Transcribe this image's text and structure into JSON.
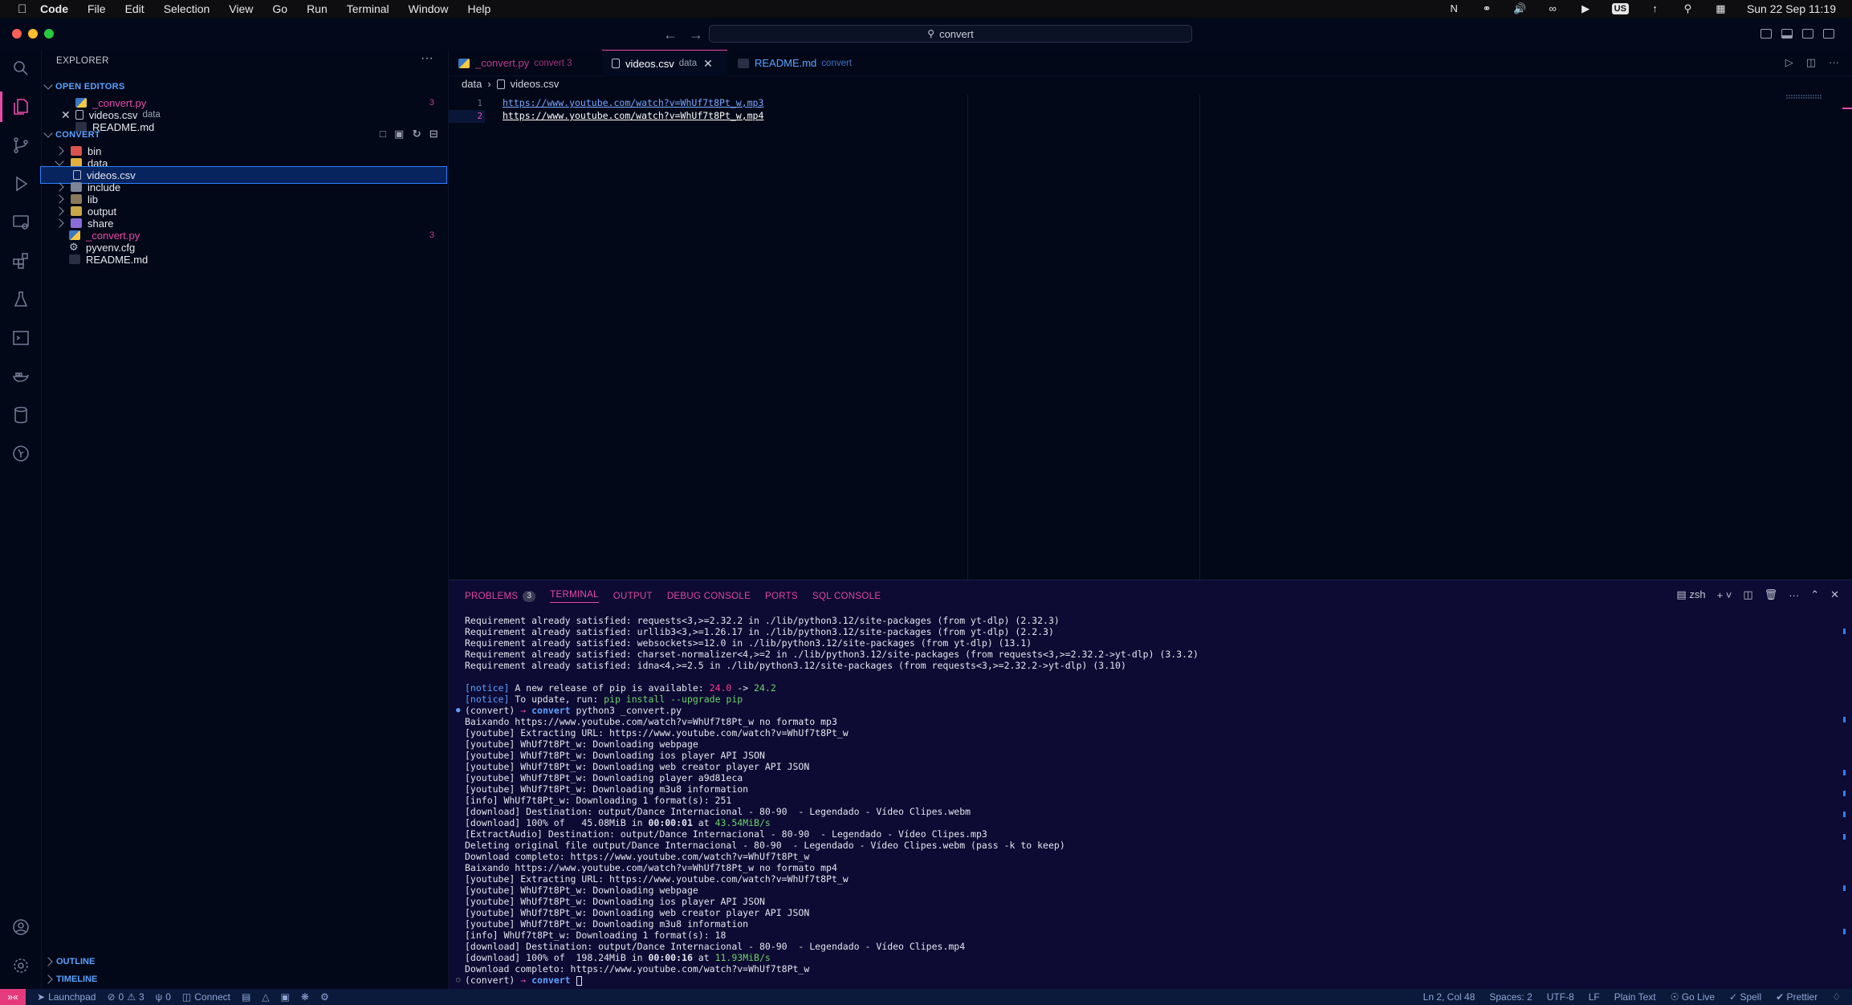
{
  "menubar": {
    "app": "Code",
    "items": [
      "File",
      "Edit",
      "Selection",
      "View",
      "Go",
      "Run",
      "Terminal",
      "Window",
      "Help"
    ],
    "clock": "Sun 22 Sep  11:19",
    "input": "US"
  },
  "titlebar": {
    "search": "convert"
  },
  "explorer": {
    "title": "EXPLORER",
    "open_editors_label": "OPEN EDITORS",
    "open_editors": [
      {
        "name": "_convert.py",
        "badge": "3"
      },
      {
        "name": "videos.csv",
        "desc": "data"
      },
      {
        "name": "README.md"
      }
    ],
    "folder_label": "CONVERT",
    "tree": [
      {
        "name": "bin"
      },
      {
        "name": "data"
      },
      {
        "name": "videos.csv"
      },
      {
        "name": "include"
      },
      {
        "name": "lib"
      },
      {
        "name": "output"
      },
      {
        "name": "share"
      },
      {
        "name": "_convert.py",
        "badge": "3"
      },
      {
        "name": "pyvenv.cfg"
      },
      {
        "name": "README.md"
      }
    ],
    "outline": "OUTLINE",
    "timeline": "TIMELINE"
  },
  "tabs": [
    {
      "name": "_convert.py",
      "desc": "convert 3"
    },
    {
      "name": "videos.csv",
      "desc": "data"
    },
    {
      "name": "README.md",
      "desc": "convert"
    }
  ],
  "breadcrumb": {
    "folder": "data",
    "file": "videos.csv"
  },
  "editor": {
    "lines": [
      {
        "num": "1",
        "text": "https://www.youtube.com/watch?v=WhUf7t8Pt_w,mp3"
      },
      {
        "num": "2",
        "text": "https://www.youtube.com/watch?v=WhUf7t8Pt_w,mp4"
      }
    ]
  },
  "panel": {
    "tabs": [
      "PROBLEMS",
      "TERMINAL",
      "OUTPUT",
      "DEBUG CONSOLE",
      "PORTS",
      "SQL CONSOLE"
    ],
    "problems_count": "3",
    "shell": "zsh"
  },
  "terminal": [
    "Requirement already satisfied: requests<3,>=2.32.2 in ./lib/python3.12/site-packages (from yt-dlp) (2.32.3)",
    "Requirement already satisfied: urllib3<3,>=1.26.17 in ./lib/python3.12/site-packages (from yt-dlp) (2.2.3)",
    "Requirement already satisfied: websockets>=12.0 in ./lib/python3.12/site-packages (from yt-dlp) (13.1)",
    "Requirement already satisfied: charset-normalizer<4,>=2 in ./lib/python3.12/site-packages (from requests<3,>=2.32.2->yt-dlp) (3.3.2)",
    "Requirement already satisfied: idna<4,>=2.5 in ./lib/python3.12/site-packages (from requests<3,>=2.32.2->yt-dlp) (3.10)",
    "",
    "[notice] A new release of pip is available: 24.0 -> 24.2",
    "[notice] To update, run: pip install --upgrade pip",
    "(convert) → convert python3 _convert.py",
    "Baixando https://www.youtube.com/watch?v=WhUf7t8Pt_w no formato mp3",
    "[youtube] Extracting URL: https://www.youtube.com/watch?v=WhUf7t8Pt_w",
    "[youtube] WhUf7t8Pt_w: Downloading webpage",
    "[youtube] WhUf7t8Pt_w: Downloading ios player API JSON",
    "[youtube] WhUf7t8Pt_w: Downloading web creator player API JSON",
    "[youtube] WhUf7t8Pt_w: Downloading player a9d81eca",
    "[youtube] WhUf7t8Pt_w: Downloading m3u8 information",
    "[info] WhUf7t8Pt_w: Downloading 1 format(s): 251",
    "[download] Destination: output/Dance Internacional - 80-90  - Legendado - Vídeo Clipes.webm",
    "[download] 100% of   45.08MiB in 00:00:01 at 43.54MiB/s",
    "[ExtractAudio] Destination: output/Dance Internacional - 80-90  - Legendado - Vídeo Clipes.mp3",
    "Deleting original file output/Dance Internacional - 80-90  - Legendado - Vídeo Clipes.webm (pass -k to keep)",
    "Download completo: https://www.youtube.com/watch?v=WhUf7t8Pt_w",
    "Baixando https://www.youtube.com/watch?v=WhUf7t8Pt_w no formato mp4",
    "[youtube] Extracting URL: https://www.youtube.com/watch?v=WhUf7t8Pt_w",
    "[youtube] WhUf7t8Pt_w: Downloading webpage",
    "[youtube] WhUf7t8Pt_w: Downloading ios player API JSON",
    "[youtube] WhUf7t8Pt_w: Downloading web creator player API JSON",
    "[youtube] WhUf7t8Pt_w: Downloading m3u8 information",
    "[info] WhUf7t8Pt_w: Downloading 1 format(s): 18",
    "[download] Destination: output/Dance Internacional - 80-90  - Legendado - Vídeo Clipes.mp4",
    "[download] 100% of  198.24MiB in 00:00:16 at 11.93MiB/s",
    "Download completo: https://www.youtube.com/watch?v=WhUf7t8Pt_w",
    "(convert) → convert "
  ],
  "status": {
    "launchpad": "Launchpad",
    "errors": "0",
    "warnings": "3",
    "ports": "0",
    "connect": "Connect",
    "position": "Ln 2, Col 48",
    "spaces": "Spaces: 2",
    "encoding": "UTF-8",
    "eol": "LF",
    "language": "Plain Text",
    "golive": "Go Live",
    "spell": "Spell",
    "prettier": "Prettier"
  },
  "colors": {
    "accent": "#e94aa9",
    "background": "#020818",
    "panel": "#0d0a33",
    "selection": "#07245f"
  }
}
